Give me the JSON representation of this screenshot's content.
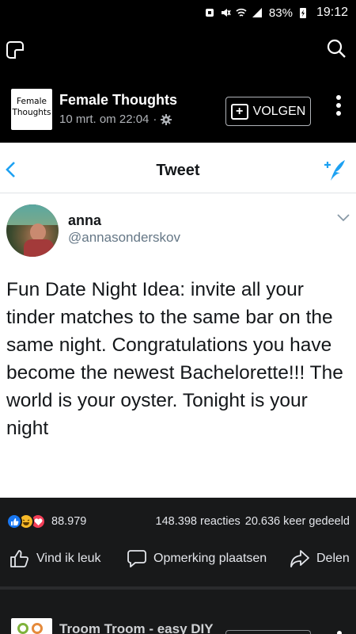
{
  "status_bar": {
    "battery": "83%",
    "time": "19:12"
  },
  "post": {
    "page_avatar_text": "Female Thoughts",
    "page_name": "Female Thoughts",
    "timestamp": "10 mrt. om 22:04",
    "separator_dot": "·",
    "follow_label": "VOLGEN"
  },
  "tweet": {
    "nav_title": "Tweet",
    "user_name": "anna",
    "user_handle": "@annasonderskov",
    "text": "Fun Date Night Idea: invite all your tinder matches to the same bar on the same night. Congratulations you have become the newest Bachelorette!!! The world is your oyster. Tonight is your night"
  },
  "stats": {
    "reaction_count": "88.979",
    "reactions_label": "148.398 reacties",
    "shares_label": "20.636 keer gedeeld"
  },
  "actions": {
    "like": "Vind ik leuk",
    "comment": "Opmerking plaatsen",
    "share": "Delen"
  },
  "next_post": {
    "page_name": "Troom Troom - easy DIY"
  },
  "colors": {
    "background": "#18191a",
    "header": "#000000",
    "twitter_blue": "#1da1f2",
    "like_blue": "#1877f2",
    "love_red": "#f33e58",
    "haha_yellow": "#f7b928"
  },
  "icons": [
    "wifi-icon",
    "signal-icon",
    "mute-icon",
    "battery-icon",
    "page-switch-icon",
    "search-icon",
    "gear-icon",
    "follow-plus-icon",
    "more-options-icon",
    "back-chevron-icon",
    "compose-tweet-icon",
    "tweet-options-chevron-icon",
    "like-reaction-icon",
    "haha-reaction-icon",
    "love-reaction-icon",
    "thumbs-up-icon",
    "comment-icon",
    "share-icon"
  ]
}
